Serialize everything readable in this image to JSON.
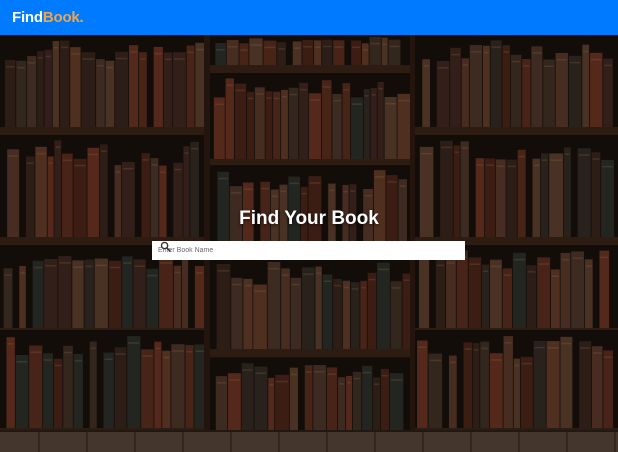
{
  "navbar": {
    "brand_part1": "Find",
    "brand_part2": "Book."
  },
  "hero": {
    "title": "Find Your Book"
  },
  "search": {
    "placeholder": "Enter Book Name",
    "value": ""
  },
  "colors": {
    "navbar": "#007bff",
    "brand_accent": "#f0a54a",
    "search_bg": "#ffffff"
  },
  "icons": {
    "search": "search-icon"
  }
}
